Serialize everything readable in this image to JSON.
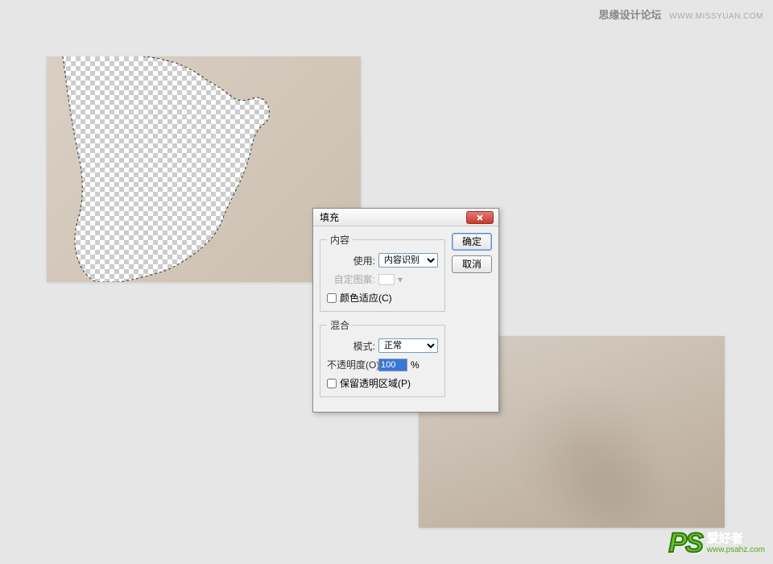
{
  "watermark_top": {
    "text": "思缘设计论坛",
    "url": "WWW.MISSYUAN.COM"
  },
  "watermark_bottom": {
    "ps": "PS",
    "cn": "爱好者",
    "en": "www.psahz.com"
  },
  "dialog": {
    "title": "填充",
    "ok_label": "确定",
    "cancel_label": "取消",
    "content": {
      "legend": "内容",
      "use_label": "使用:",
      "use_value": "内容识别",
      "pattern_label": "自定图案:",
      "color_adapt_label": "颜色适应(C)"
    },
    "blend": {
      "legend": "混合",
      "mode_label": "模式:",
      "mode_value": "正常",
      "opacity_label": "不透明度(O):",
      "opacity_value": "100",
      "opacity_unit": "%",
      "preserve_label": "保留透明区域(P)"
    }
  }
}
